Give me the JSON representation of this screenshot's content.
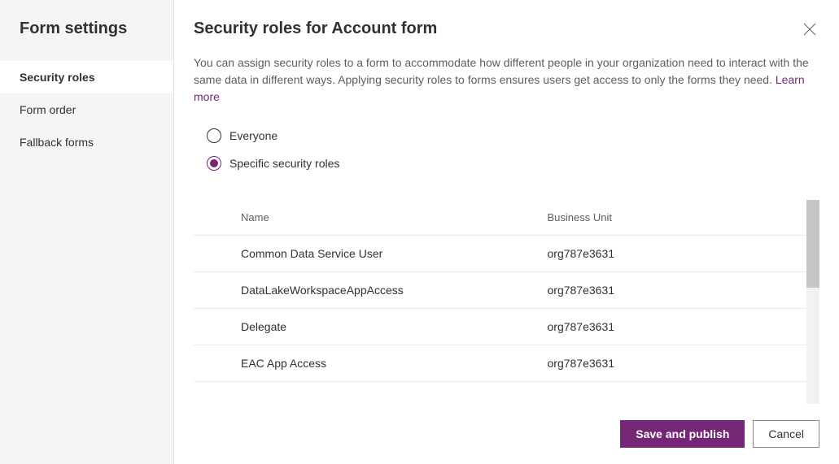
{
  "sidebar": {
    "title": "Form settings",
    "items": [
      {
        "label": "Security roles",
        "active": true
      },
      {
        "label": "Form order",
        "active": false
      },
      {
        "label": "Fallback forms",
        "active": false
      }
    ]
  },
  "main": {
    "title": "Security roles for Account form",
    "description": "You can assign security roles to a form to accommodate how different people in your organization need to interact with the same data in different ways. Applying security roles to forms ensures users get access to only the forms they need. ",
    "learn_more": "Learn more"
  },
  "radio": {
    "everyone": "Everyone",
    "specific": "Specific security roles",
    "selected": "specific"
  },
  "table": {
    "headers": {
      "name": "Name",
      "business_unit": "Business Unit"
    },
    "rows": [
      {
        "name": "Common Data Service User",
        "business_unit": "org787e3631"
      },
      {
        "name": "DataLakeWorkspaceAppAccess",
        "business_unit": "org787e3631"
      },
      {
        "name": "Delegate",
        "business_unit": "org787e3631"
      },
      {
        "name": "EAC App Access",
        "business_unit": "org787e3631"
      }
    ]
  },
  "footer": {
    "save_publish": "Save and publish",
    "cancel": "Cancel"
  }
}
